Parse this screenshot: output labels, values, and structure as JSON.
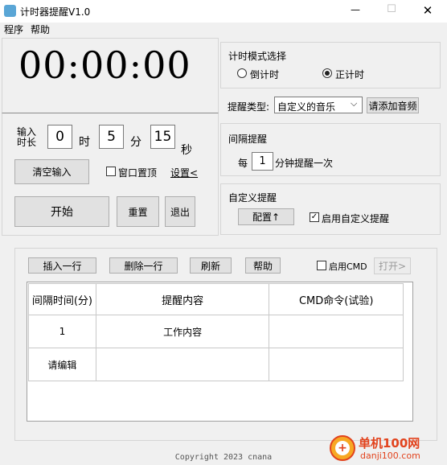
{
  "window": {
    "title": "计时器提醒V1.0",
    "min_symbol": "—",
    "max_symbol": "☐",
    "close_symbol": "✕"
  },
  "menu": [
    "程序",
    "帮助"
  ],
  "timer": {
    "display": "00:00:00",
    "input_label": "输入\n时长",
    "hours": "0",
    "hours_unit": "时",
    "minutes": "5",
    "minutes_unit": "分",
    "seconds": "15",
    "seconds_unit": "秒",
    "clear_label": "清空输入",
    "on_top_label": "窗口置顶",
    "settings_label": "设置<",
    "start_label": "开始",
    "reset_label": "重置",
    "exit_label": "退出"
  },
  "mode": {
    "title": "计时模式选择",
    "countdown_label": "倒计时",
    "countup_label": "正计时",
    "selected": "countup"
  },
  "reminder_type": {
    "label": "提醒类型:",
    "value": "自定义的音乐",
    "add_audio_label": "请添加音频"
  },
  "interval": {
    "title": "间隔提醒",
    "prefix": "每",
    "value": "1",
    "suffix": "分钟提醒一次"
  },
  "custom": {
    "title": "自定义提醒",
    "config_label": "配置↑",
    "enable_label": "启用自定义提醒",
    "enabled": true
  },
  "toolbar": {
    "insert_label": "插入一行",
    "delete_label": "删除一行",
    "refresh_label": "刷新",
    "help_label": "帮助",
    "cmd_label": "启用CMD",
    "open_label": "打开>"
  },
  "table": {
    "headers": [
      "间隔时间(分)",
      "提醒内容",
      "CMD命令(试验)"
    ],
    "rows": [
      [
        "1",
        "工作内容",
        ""
      ],
      [
        "请编辑",
        "",
        ""
      ]
    ]
  },
  "footer": "Copyright 2023 cnana",
  "watermark": {
    "name": "单机100网",
    "url": "danji100.com"
  },
  "colors": {
    "title_icon": "#5aa6d6",
    "watermark_orange": "#e2431d"
  }
}
